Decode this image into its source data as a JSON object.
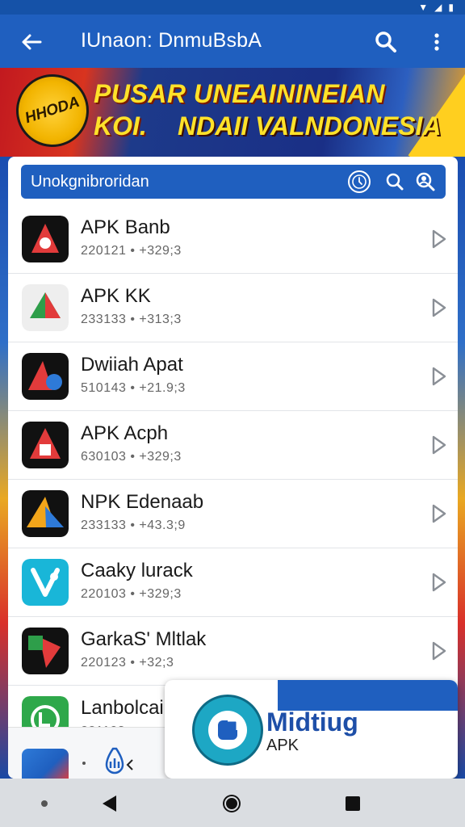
{
  "appbar": {
    "title": "IUnaon: DnmuBsbA"
  },
  "banner": {
    "logo_text": "HHODA",
    "line1": "PUSAR UNEAININEIAN",
    "line2a": "KOI.",
    "line2b": "NDAII VALNDONESIA"
  },
  "search": {
    "placeholder": "Unokgnibroridan"
  },
  "apps": [
    {
      "name": "APK Banb",
      "meta": "220121  • +329;3",
      "icon_colors": [
        "#111111",
        "#e23b3b",
        "#ffffff"
      ]
    },
    {
      "name": "APK KK",
      "meta": "233133  • +313;3",
      "icon_colors": [
        "#eeeeee",
        "#2e9e4a",
        "#e23b3b"
      ]
    },
    {
      "name": "Dwiiah Apat",
      "meta": "510143  • +21.9;3",
      "icon_colors": [
        "#111111",
        "#e23b3b",
        "#2e7ad8"
      ]
    },
    {
      "name": "APK Acph",
      "meta": "630103  • +329;3",
      "icon_colors": [
        "#111111",
        "#e23b3b",
        "#ffffff"
      ]
    },
    {
      "name": "NPK Edenaab",
      "meta": "233133  • +43.3;9",
      "icon_colors": [
        "#111111",
        "#f2a51a",
        "#2e7ad8"
      ]
    },
    {
      "name": "Caaky lurack",
      "meta": "220103  • +329;3",
      "icon_colors": [
        "#19b6d8",
        "#ffffff",
        "#19b6d8"
      ]
    },
    {
      "name": "GarkaS' Mltlak",
      "meta": "220123  • +32;3",
      "icon_colors": [
        "#111111",
        "#e23b3b",
        "#2e9e4a"
      ]
    },
    {
      "name": "Lanbolcai",
      "meta": "221103",
      "icon_colors": [
        "#2ea84a",
        "#ffffff",
        "#2ea84a"
      ]
    }
  ],
  "popup": {
    "title": "Midtiug",
    "subtitle": "APK"
  },
  "colors": {
    "primary": "#1f5fbf",
    "accent_yellow": "#ffe22a",
    "accent_red": "#e23b3b"
  }
}
